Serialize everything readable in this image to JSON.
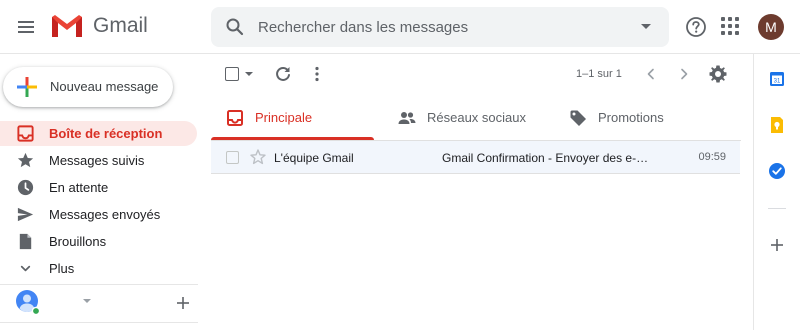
{
  "header": {
    "logo_text": "Gmail",
    "search_placeholder": "Rechercher dans les messages",
    "avatar_initial": "M"
  },
  "compose": {
    "label": "Nouveau message"
  },
  "sidebar": {
    "items": [
      {
        "label": "Boîte de réception",
        "icon": "inbox-icon",
        "active": true
      },
      {
        "label": "Messages suivis",
        "icon": "star-icon"
      },
      {
        "label": "En attente",
        "icon": "clock-icon"
      },
      {
        "label": "Messages envoyés",
        "icon": "send-icon"
      },
      {
        "label": "Brouillons",
        "icon": "draft-icon"
      },
      {
        "label": "Plus",
        "icon": "chevron-down-icon"
      }
    ]
  },
  "toolbar": {
    "pager_text": "1–1 sur 1"
  },
  "tabs": [
    {
      "label": "Principale",
      "icon": "inbox-icon",
      "active": true
    },
    {
      "label": "Réseaux sociaux",
      "icon": "people-icon"
    },
    {
      "label": "Promotions",
      "icon": "tag-icon"
    }
  ],
  "emails": [
    {
      "sender": "L'équipe Gmail",
      "subject": "Gmail Confirmation - Envoyer des e-…",
      "time": "09:59"
    }
  ],
  "colors": {
    "accent_red": "#d93025",
    "active_bg": "#fce8e6",
    "row_bg": "#f2f6fc",
    "icon_grey": "#5f6368"
  }
}
